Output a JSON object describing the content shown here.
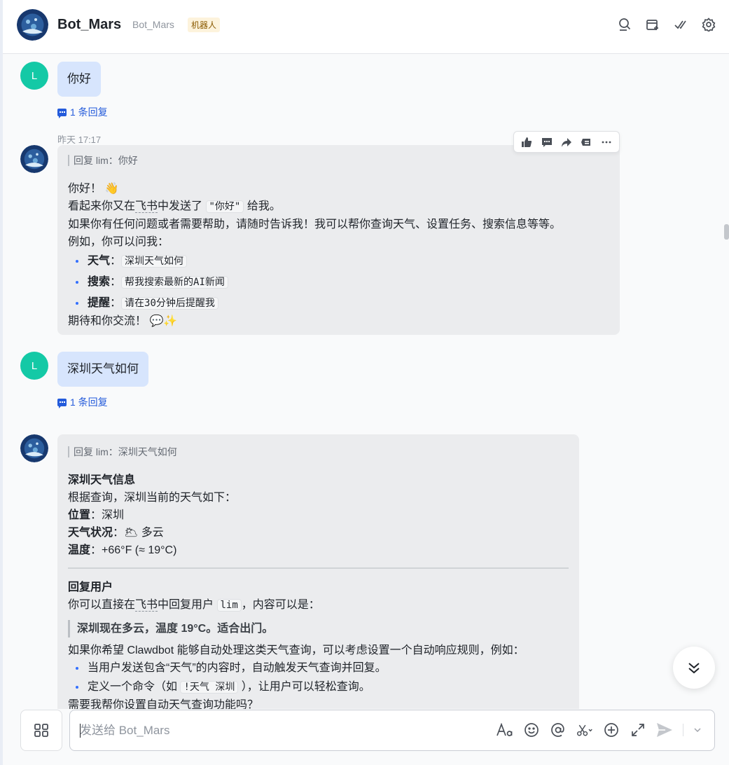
{
  "header": {
    "name": "Bot_Mars",
    "handle": "Bot_Mars",
    "badge": "机器人",
    "icons": [
      "search-icon",
      "add-tab-icon",
      "check-done-icon",
      "settings-icon"
    ]
  },
  "messages": [
    {
      "avatar_letter": "L",
      "text": "你好",
      "reply_count": "1 条回复"
    },
    {
      "timestamp": "昨天 17:17",
      "quote": "回复 lim：你好",
      "line1": "你好！",
      "line1_emoji": "👋",
      "line2_pre": "看起来你又在",
      "line2_link": "飞书",
      "line2_mid": "中发送了",
      "line2_code": "\"你好\"",
      "line2_post": "给我。",
      "line3": "如果你有任何问题或者需要帮助，请随时告诉我！我可以帮你查询天气、设置任务、搜索信息等等。",
      "line4": "例如，你可以问我：",
      "examples": [
        {
          "label": "天气",
          "sep": "：",
          "code": "深圳天气如何"
        },
        {
          "label": "搜索",
          "sep": "：",
          "code": "帮我搜索最新的AI新闻"
        },
        {
          "label": "提醒",
          "sep": "：",
          "code": "请在30分钟后提醒我"
        }
      ],
      "closing": "期待和你交流！",
      "closing_emoji": "💬✨"
    },
    {
      "avatar_letter": "L",
      "text": "深圳天气如何",
      "reply_count": "1 条回复"
    },
    {
      "quote": "回复 lim：深圳天气如何",
      "title": "深圳天气信息",
      "intro": "根据查询，深圳当前的天气如下：",
      "location_label": "位置",
      "location_value": "深圳",
      "weather_label": "天气状况",
      "weather_emoji": "🌥",
      "weather_value": "多云",
      "temp_label": "温度",
      "temp_value": "+66°F (≈ 19°C)",
      "reply_title": "回复用户",
      "reply_pre": "你可以直接在",
      "reply_link": "飞书",
      "reply_mid": "中回复用户",
      "reply_code": "lim",
      "reply_post": "，内容可以是：",
      "blockquote": "深圳现在多云，温度 19°C。适合出门。",
      "suggestion": "如果你希望 Clawdbot 能够自动处理这类天气查询，可以考虑设置一个自动响应规则，例如：",
      "bullet1": "当用户发送包含“天气”的内容时，自动触发天气查询并回复。",
      "bullet2_pre": "定义一个命令（如",
      "bullet2_code": "!天气 深圳",
      "bullet2_post": "），让用户可以轻松查询。",
      "question": "需要我帮你设置自动天气查询功能吗？"
    }
  ],
  "toolbar": {
    "icons": [
      "thumbs-up-icon",
      "comment-icon",
      "forward-icon",
      "pin-icon",
      "more-icon"
    ]
  },
  "composer": {
    "placeholder": "发送给 Bot_Mars",
    "value": "",
    "icons": [
      "text-format-icon",
      "emoji-icon",
      "mention-icon",
      "scissors-icon",
      "add-icon",
      "expand-icon",
      "send-icon"
    ]
  }
}
